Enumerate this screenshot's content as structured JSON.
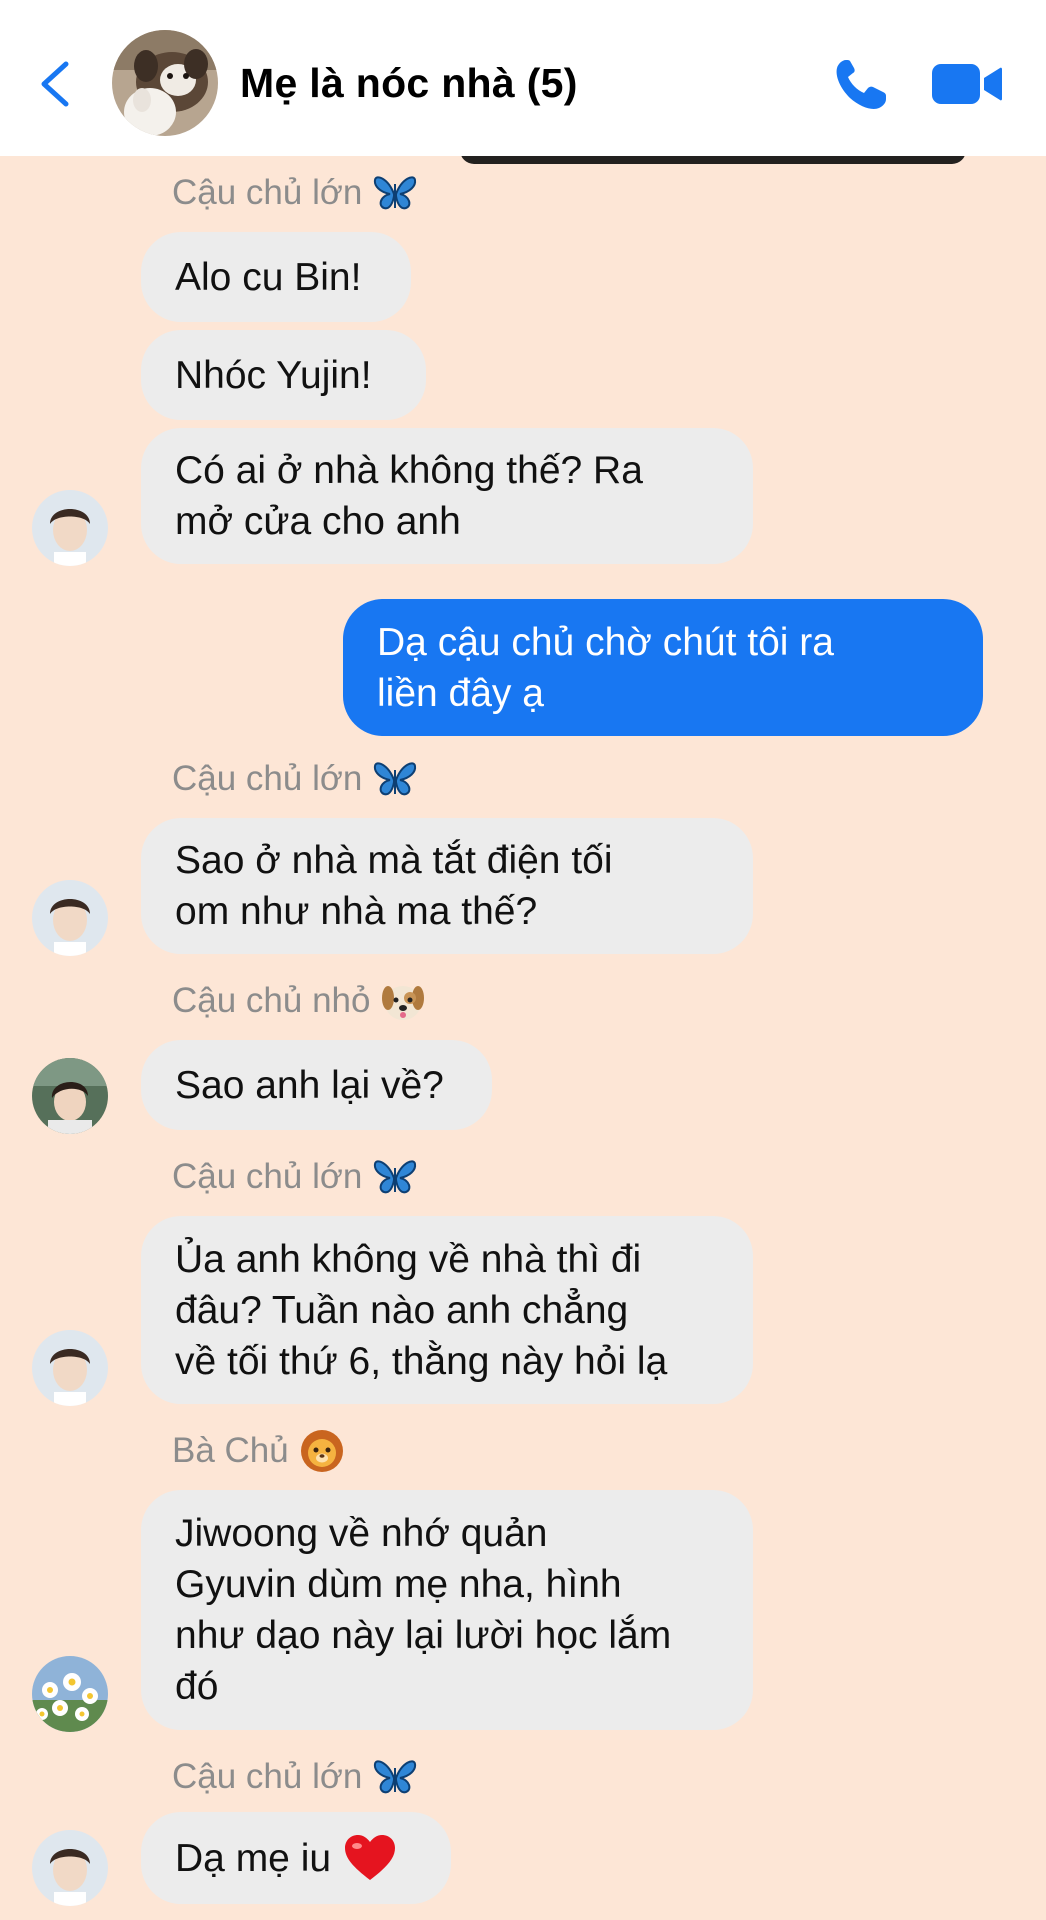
{
  "header": {
    "title": "Mẹ là nóc nhà (5)",
    "icons": {
      "back": "chevron-left-icon",
      "call": "phone-icon",
      "video": "video-camera-icon"
    },
    "accent": "#1877f2"
  },
  "colors": {
    "chat_background": "#fde6d6",
    "incoming_bubble": "#ececec",
    "outgoing_bubble": "#1877f2",
    "sender_text": "#8c8c8c"
  },
  "messages": {
    "s1": {
      "sender": "Cậu chủ lớn",
      "emoji": "butterfly"
    },
    "m1": "Alo cu Bin!",
    "m2": "Nhóc Yujin!",
    "m3": "Có ai ở nhà không thế? Ra\nmở cửa cho anh",
    "m4": "Dạ cậu chủ chờ chút tôi ra\nliền đây ạ",
    "s2": {
      "sender": "Cậu chủ lớn",
      "emoji": "butterfly"
    },
    "m5": "Sao ở nhà mà tắt điện tối\nom như nhà ma thế?",
    "s3": {
      "sender": "Cậu chủ nhỏ",
      "emoji": "dog-face"
    },
    "m6": "Sao anh lại về?",
    "s4": {
      "sender": "Cậu chủ lớn",
      "emoji": "butterfly"
    },
    "m7": "Ủa anh không về nhà thì đi\nđâu? Tuần nào anh chẳng\nvề tối thứ 6, thằng này hỏi lạ",
    "s5": {
      "sender": "Bà Chủ",
      "emoji": "lion-face"
    },
    "m8": "Jiwoong về nhớ quản\nGyuvin dùm mẹ nha, hình\nnhư dạo này lại lười học lắm\nđó",
    "s6": {
      "sender": "Cậu chủ lớn",
      "emoji": "butterfly"
    },
    "m9": "Dạ mẹ iu",
    "m9_emoji": "red-heart"
  }
}
